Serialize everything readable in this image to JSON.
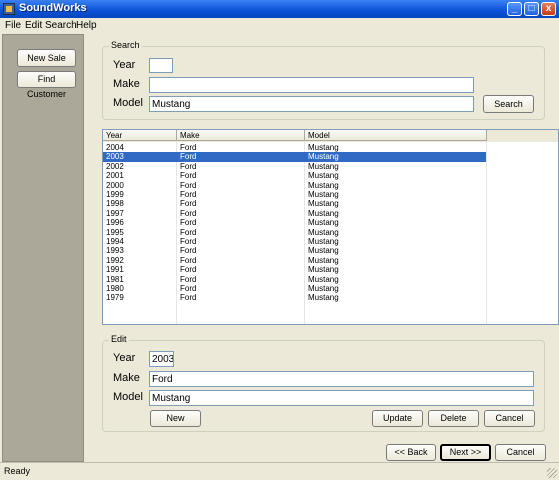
{
  "window": {
    "title": "SoundWorks",
    "controls": {
      "minimize": "_",
      "maximize": "□",
      "close": "x"
    }
  },
  "menu": [
    "File",
    "Edit",
    "Search",
    "Help"
  ],
  "sidebar": {
    "new_sale": "New Sale",
    "find_customer": "Find Customer"
  },
  "search": {
    "group_label": "Search",
    "year_label": "Year",
    "make_label": "Make",
    "model_label": "Model",
    "year_value": "",
    "make_value": "",
    "model_value": "Mustang",
    "search_button": "Search"
  },
  "grid": {
    "columns": [
      "Year",
      "Make",
      "Model"
    ],
    "rows": [
      {
        "year": "2004",
        "make": "Ford",
        "model": "Mustang"
      },
      {
        "year": "2003",
        "make": "Ford",
        "model": "Mustang",
        "selected": true
      },
      {
        "year": "2002",
        "make": "Ford",
        "model": "Mustang"
      },
      {
        "year": "2001",
        "make": "Ford",
        "model": "Mustang"
      },
      {
        "year": "2000",
        "make": "Ford",
        "model": "Mustang"
      },
      {
        "year": "1999",
        "make": "Ford",
        "model": "Mustang"
      },
      {
        "year": "1998",
        "make": "Ford",
        "model": "Mustang"
      },
      {
        "year": "1997",
        "make": "Ford",
        "model": "Mustang"
      },
      {
        "year": "1996",
        "make": "Ford",
        "model": "Mustang"
      },
      {
        "year": "1995",
        "make": "Ford",
        "model": "Mustang"
      },
      {
        "year": "1994",
        "make": "Ford",
        "model": "Mustang"
      },
      {
        "year": "1993",
        "make": "Ford",
        "model": "Mustang"
      },
      {
        "year": "1992",
        "make": "Ford",
        "model": "Mustang"
      },
      {
        "year": "1991",
        "make": "Ford",
        "model": "Mustang"
      },
      {
        "year": "1981",
        "make": "Ford",
        "model": "Mustang"
      },
      {
        "year": "1980",
        "make": "Ford",
        "model": "Mustang"
      },
      {
        "year": "1979",
        "make": "Ford",
        "model": "Mustang"
      }
    ]
  },
  "edit": {
    "group_label": "Edit",
    "year_label": "Year",
    "make_label": "Make",
    "model_label": "Model",
    "year_value": "2003",
    "make_value": "Ford",
    "model_value": "Mustang",
    "new_button": "New",
    "update_button": "Update",
    "delete_button": "Delete",
    "cancel_button": "Cancel"
  },
  "nav": {
    "back": "<< Back",
    "next": "Next >>",
    "cancel": "Cancel"
  },
  "status": "Ready",
  "colors": {
    "titlebar": "#0a52d6",
    "selection": "#316ac5",
    "sidebar": "#aca899",
    "window": "#ece9d8"
  }
}
